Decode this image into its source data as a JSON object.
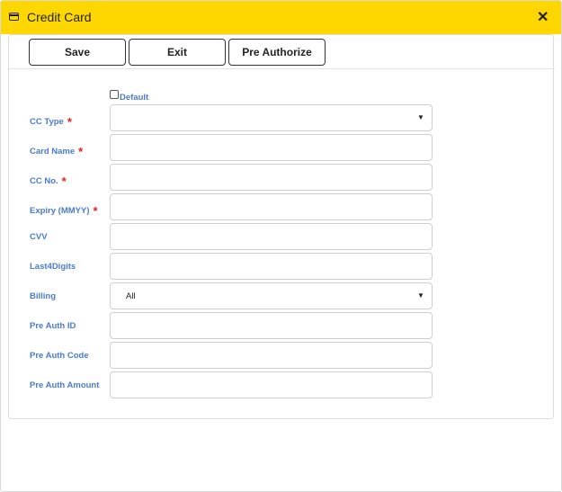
{
  "window": {
    "title": "Credit Card"
  },
  "toolbar": {
    "save": "Save",
    "exit": "Exit",
    "pre_authorize": "Pre Authorize"
  },
  "form": {
    "default_label": "Default",
    "default_checked": false,
    "required_mark": "*",
    "cc_type": {
      "label": "CC Type",
      "value": ""
    },
    "card_name": {
      "label": "Card Name",
      "value": ""
    },
    "cc_no": {
      "label": "CC No.",
      "value": ""
    },
    "expiry": {
      "label": "Expiry (MMYY)",
      "value": ""
    },
    "cvv": {
      "label": "CVV",
      "value": ""
    },
    "last4": {
      "label": "Last4Digits",
      "value": ""
    },
    "billing": {
      "label": "Billing",
      "value": "All"
    },
    "pre_auth_id": {
      "label": "Pre Auth ID",
      "value": ""
    },
    "pre_auth_code": {
      "label": "Pre Auth Code",
      "value": ""
    },
    "pre_auth_amount": {
      "label": "Pre Auth Amount",
      "value": ""
    }
  },
  "icons": {
    "title": "credit-card-window-icon",
    "close": "close-icon",
    "dropdown": "triangle-down-icon"
  },
  "colors": {
    "titlebar": "#ffd700",
    "label": "#4a7bd0",
    "required": "#e02020"
  }
}
